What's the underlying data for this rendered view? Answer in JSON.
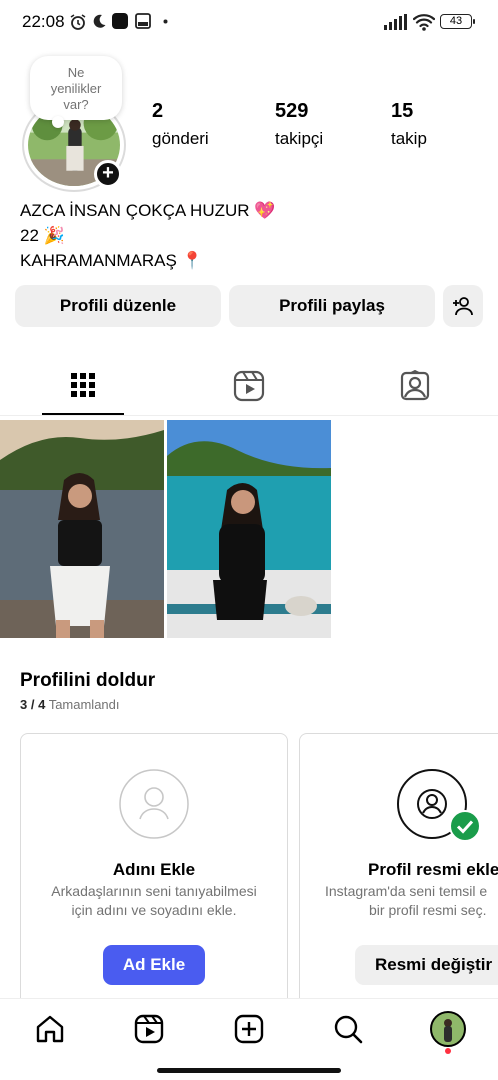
{
  "status_bar": {
    "time": "22:08",
    "battery": "43",
    "icons": [
      "alarm-icon",
      "moon-icon",
      "app-icon",
      "screen-icon",
      "dot-icon",
      "signal-icon",
      "wifi-icon",
      "battery-icon"
    ]
  },
  "profile": {
    "note_text": "Ne yenilikler var?",
    "stats": [
      {
        "value": "2",
        "label": "gönderi"
      },
      {
        "value": "529",
        "label": "takipçi"
      },
      {
        "value": "15",
        "label": "takip"
      }
    ],
    "bio_lines": [
      "AZCA İNSAN ÇOKÇA HUZUR 💖",
      "22 🎉",
      "KAHRAMANMARAŞ 📍"
    ]
  },
  "actions": {
    "edit_profile": "Profili düzenle",
    "share_profile": "Profili paylaş"
  },
  "tabs": [
    "grid-tab",
    "reels-tab",
    "tagged-tab"
  ],
  "complete_profile": {
    "title": "Profilini doldur",
    "progress": "3 / 4",
    "progress_label": "Tamamlandı",
    "cards": [
      {
        "title": "Adını Ekle",
        "desc_line1": "Arkadaşlarının seni tanıyabilmesi",
        "desc_line2": "için adını ve soyadını ekle.",
        "button": "Ad Ekle"
      },
      {
        "title": "Profil resmi ekle",
        "desc_line1": "Instagram'da seni temsil e",
        "desc_line2": "bir profil resmi seç.",
        "button": "Resmi değiştir"
      }
    ]
  },
  "colors": {
    "accent": "#4a5cf0",
    "button_bg": "#efefef",
    "check_green": "#1a9c4a",
    "muted": "#737373"
  }
}
